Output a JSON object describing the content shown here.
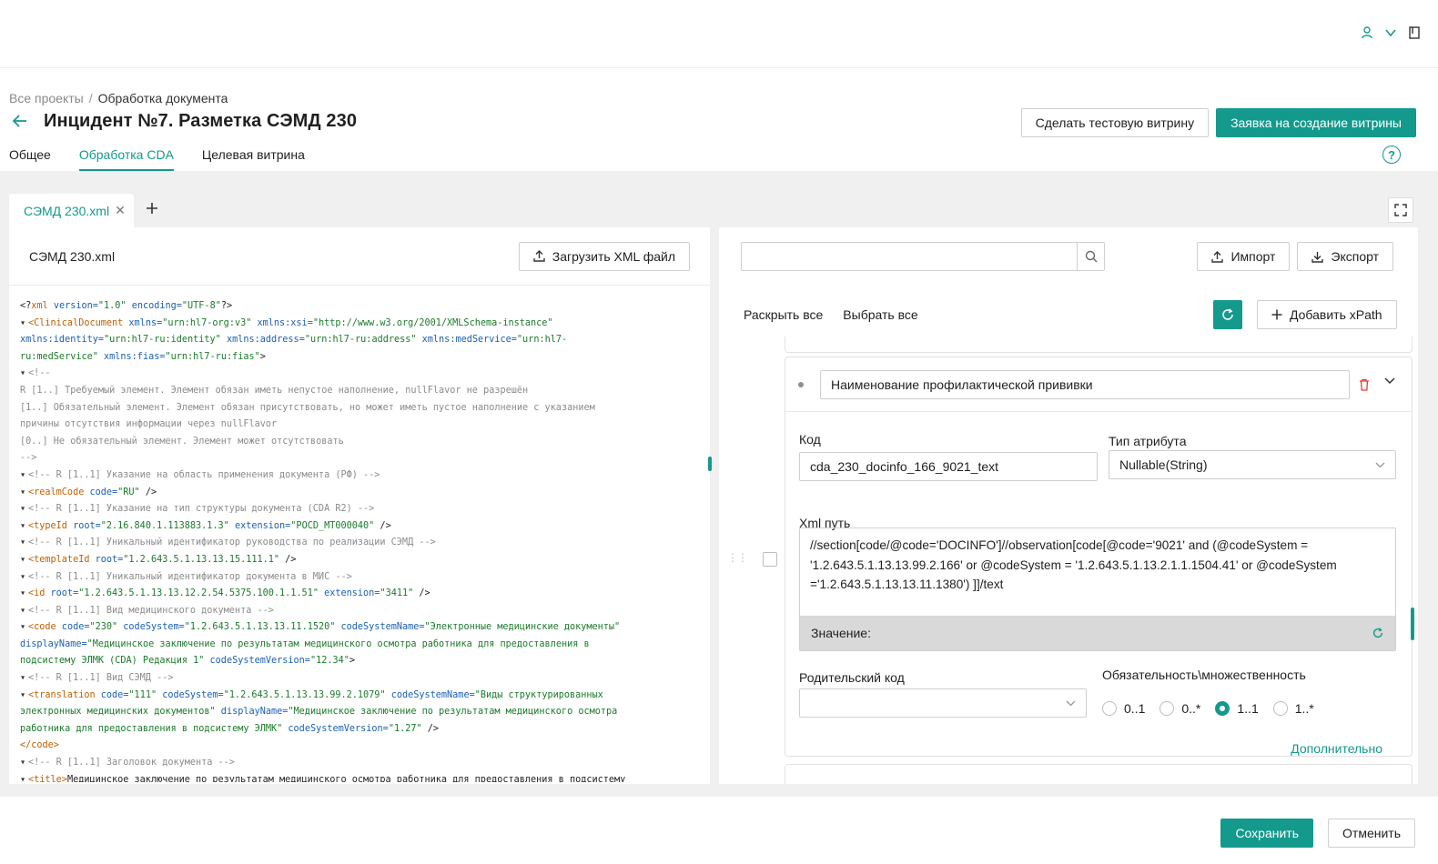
{
  "breadcrumb": {
    "root": "Все проекты",
    "sep": "/",
    "current": "Обработка документа"
  },
  "page": {
    "title": "Инцидент №7. Разметка СЭМД 230"
  },
  "header_buttons": {
    "test_showcase": "Сделать тестовую витрину",
    "request_showcase": "Заявка на создание витрины"
  },
  "tabs": [
    {
      "label": "Общее",
      "active": false
    },
    {
      "label": "Обработка CDA",
      "active": true
    },
    {
      "label": "Целевая витрина",
      "active": false
    }
  ],
  "file_tab": {
    "label": "СЭМД 230.xml"
  },
  "left_panel": {
    "file_name": "СЭМД 230.xml",
    "upload_button": "Загрузить XML файл",
    "xml_lines": [
      [
        [
          "",
          "<?"
        ],
        [
          "t",
          "xml"
        ],
        [
          "a",
          " version="
        ],
        [
          "v",
          "\"1.0\""
        ],
        [
          "a",
          " encoding="
        ],
        [
          "v",
          "\"UTF-8\""
        ],
        [
          "",
          "?>"
        ]
      ],
      [
        [
          "tri",
          "▾"
        ],
        [
          "t",
          "<ClinicalDocument"
        ],
        [
          "a",
          " xmlns="
        ],
        [
          "v",
          "\"urn:hl7-org:v3\""
        ],
        [
          "a",
          " xmlns:xsi="
        ],
        [
          "v",
          "\"http://www.w3.org/2001/XMLSchema-instance\""
        ]
      ],
      [
        [
          "a",
          "xmlns:identity="
        ],
        [
          "v",
          "\"urn:hl7-ru:identity\""
        ],
        [
          "a",
          " xmlns:address="
        ],
        [
          "v",
          "\"urn:hl7-ru:address\""
        ],
        [
          "a",
          " xmlns:medService="
        ],
        [
          "v",
          "\"urn:hl7-"
        ]
      ],
      [
        [
          "v",
          "ru:medService\""
        ],
        [
          "a",
          " xmlns:fias="
        ],
        [
          "v",
          "\"urn:hl7-ru:fias\""
        ],
        [
          "",
          ">"
        ]
      ],
      [
        [
          "",
          " "
        ],
        [
          "tri",
          "▾"
        ],
        [
          "c",
          "<!--"
        ]
      ],
      [
        [
          "c",
          "     R [1..] Требуемый элемент. Элемент обязан иметь непустое наполнение, nullFlavor не разрешён"
        ]
      ],
      [
        [
          "c",
          "     [1..] Обязательный элемент. Элемент обязан присутствовать, но может иметь пустое наполнение с указанием"
        ]
      ],
      [
        [
          "c",
          "причины отсутствия информации через nullFlavor"
        ]
      ],
      [
        [
          "c",
          "     [0..] Не обязательный элемент. Элемент может отсутствовать"
        ]
      ],
      [
        [
          "c",
          "   -->"
        ]
      ],
      [
        [
          "",
          " "
        ],
        [
          "tri",
          "▾"
        ],
        [
          "c",
          "<!--  R [1..1] Указание на область применения документа (РФ)  -->"
        ]
      ],
      [
        [
          "",
          " "
        ],
        [
          "tri",
          "▾"
        ],
        [
          "t",
          "<realmCode"
        ],
        [
          "a",
          " code="
        ],
        [
          "v",
          "\"RU\""
        ],
        [
          "",
          " />"
        ]
      ],
      [
        [
          "",
          " "
        ],
        [
          "tri",
          "▾"
        ],
        [
          "c",
          "<!--  R [1..1] Указание на тип структуры документа (CDA R2)  -->"
        ]
      ],
      [
        [
          "",
          " "
        ],
        [
          "tri",
          "▾"
        ],
        [
          "t",
          "<typeId"
        ],
        [
          "a",
          " root="
        ],
        [
          "v",
          "\"2.16.840.1.113883.1.3\""
        ],
        [
          "a",
          " extension="
        ],
        [
          "v",
          "\"POCD_MT000040\""
        ],
        [
          "",
          " />"
        ]
      ],
      [
        [
          "",
          " "
        ],
        [
          "tri",
          "▾"
        ],
        [
          "c",
          "<!--  R [1..1] Уникальный идентификатор руководства по реализации СЭМД  -->"
        ]
      ],
      [
        [
          "",
          " "
        ],
        [
          "tri",
          "▾"
        ],
        [
          "t",
          "<templateId"
        ],
        [
          "a",
          " root="
        ],
        [
          "v",
          "\"1.2.643.5.1.13.13.15.111.1\""
        ],
        [
          "",
          " />"
        ]
      ],
      [
        [
          "",
          " "
        ],
        [
          "tri",
          "▾"
        ],
        [
          "c",
          "<!--  R [1..1] Уникальный идентификатор документа в МИС  -->"
        ]
      ],
      [
        [
          "",
          " "
        ],
        [
          "tri",
          "▾"
        ],
        [
          "t",
          "<id"
        ],
        [
          "a",
          " root="
        ],
        [
          "v",
          "\"1.2.643.5.1.13.13.12.2.54.5375.100.1.1.51\""
        ],
        [
          "a",
          " extension="
        ],
        [
          "v",
          "\"3411\""
        ],
        [
          "",
          " />"
        ]
      ],
      [
        [
          "",
          " "
        ],
        [
          "tri",
          "▾"
        ],
        [
          "c",
          "<!--  R [1..1] Вид медицинского документа  -->"
        ]
      ],
      [
        [
          "",
          " "
        ],
        [
          "tri",
          "▾"
        ],
        [
          "t",
          "<code"
        ],
        [
          "a",
          " code="
        ],
        [
          "v",
          "\"230\""
        ],
        [
          "a",
          " codeSystem="
        ],
        [
          "v",
          "\"1.2.643.5.1.13.13.11.1520\""
        ],
        [
          "a",
          " codeSystemName="
        ],
        [
          "v",
          "\"Электронные медицинские документы\""
        ]
      ],
      [
        [
          "a",
          "displayName="
        ],
        [
          "v",
          "\"Медицинское заключение по результатам медицинского осмотра работника для предоставления в"
        ]
      ],
      [
        [
          "v",
          "подсистему ЭЛМК (CDA) Редакция 1\""
        ],
        [
          "a",
          " codeSystemVersion="
        ],
        [
          "v",
          "\"12.34\""
        ],
        [
          "",
          ">"
        ]
      ],
      [
        [
          "",
          "    "
        ],
        [
          "tri",
          "▾"
        ],
        [
          "c",
          "<!--  R [1..1] Вид СЭМД  -->"
        ]
      ],
      [
        [
          "",
          "    "
        ],
        [
          "tri",
          "▾"
        ],
        [
          "t",
          "<translation"
        ],
        [
          "a",
          " code="
        ],
        [
          "v",
          "\"111\""
        ],
        [
          "a",
          " codeSystem="
        ],
        [
          "v",
          "\"1.2.643.5.1.13.13.99.2.1079\""
        ],
        [
          "a",
          " codeSystemName="
        ],
        [
          "v",
          "\"Виды структурированных"
        ]
      ],
      [
        [
          "v",
          "электронных медицинских документов\""
        ],
        [
          "a",
          " displayName="
        ],
        [
          "v",
          "\"Медицинское заключение по результатам медицинского осмотра"
        ]
      ],
      [
        [
          "v",
          "работника для предоставления в подсистему ЭЛМК\""
        ],
        [
          "a",
          " codeSystemVersion="
        ],
        [
          "v",
          "\"1.27\""
        ],
        [
          "",
          " />"
        ]
      ],
      [
        [
          "",
          "   "
        ],
        [
          "t",
          "</code>"
        ]
      ],
      [
        [
          "",
          " "
        ],
        [
          "tri",
          "▾"
        ],
        [
          "c",
          "<!--  R [1..1] Заголовок документа  -->"
        ]
      ],
      [
        [
          "",
          " "
        ],
        [
          "tri",
          "▾"
        ],
        [
          "t",
          "<title>"
        ],
        [
          "",
          "Медицинское заключение по результатам медицинского осмотра работника для предоставления в подсистему"
        ]
      ]
    ]
  },
  "right_panel": {
    "search_placeholder": "",
    "import_button": "Импорт",
    "export_button": "Экспорт",
    "expand_all": "Раскрыть все",
    "select_all": "Выбрать все",
    "add_xpath_button": "Добавить xPath",
    "item": {
      "name": "Наименование профилактической прививки",
      "code_label": "Код",
      "code_value": "cda_230_docinfo_166_9021_text",
      "attr_type_label": "Тип атрибута",
      "attr_type_value": "Nullable(String)",
      "xml_path_label": "Xml путь",
      "xml_path_value": "//section[code/@code='DOCINFO']//observation[code[@code='9021' and (@codeSystem = '1.2.643.5.1.13.13.99.2.166' or @codeSystem = '1.2.643.5.1.13.2.1.1.1504.41' or @codeSystem ='1.2.643.5.1.13.13.11.1380') ]]/text",
      "value_label": "Значение:",
      "parent_code_label": "Родительский код",
      "parent_code_value": "",
      "multiplicity_label": "Обязательность\\множественность",
      "multiplicity_options": [
        "0..1",
        "0..*",
        "1..1",
        "1..*"
      ],
      "multiplicity_selected": "1..1",
      "more_link": "Дополнительно"
    }
  },
  "footer": {
    "save_button": "Сохранить",
    "cancel_button": "Отменить"
  },
  "colors": {
    "accent": "#139a8c",
    "delete": "#e53935"
  }
}
